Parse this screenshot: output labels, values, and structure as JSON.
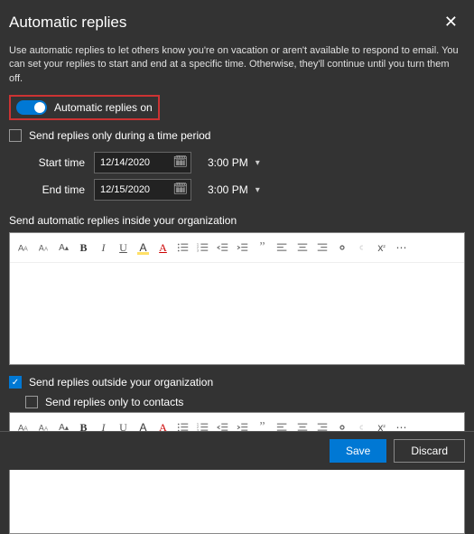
{
  "header": {
    "title": "Automatic replies"
  },
  "description": "Use automatic replies to let others know you're on vacation or aren't available to respond to email. You can set your replies to start and end at a specific time. Otherwise, they'll continue until you turn them off.",
  "toggle": {
    "label": "Automatic replies on",
    "on": true
  },
  "time_period": {
    "checkbox_label": "Send replies only during a time period",
    "checked": false,
    "start_label": "Start time",
    "end_label": "End time",
    "start_date": "12/14/2020",
    "end_date": "12/15/2020",
    "start_time": "3:00 PM",
    "end_time": "3:00 PM"
  },
  "inside_org": {
    "label": "Send automatic replies inside your organization"
  },
  "outside_org": {
    "checkbox_label": "Send replies outside your organization",
    "checked": true,
    "contacts_label": "Send replies only to contacts",
    "contacts_checked": false
  },
  "footer": {
    "save": "Save",
    "discard": "Discard"
  },
  "colors": {
    "accent": "#0078d4",
    "highlight_border": "#cc3333"
  }
}
